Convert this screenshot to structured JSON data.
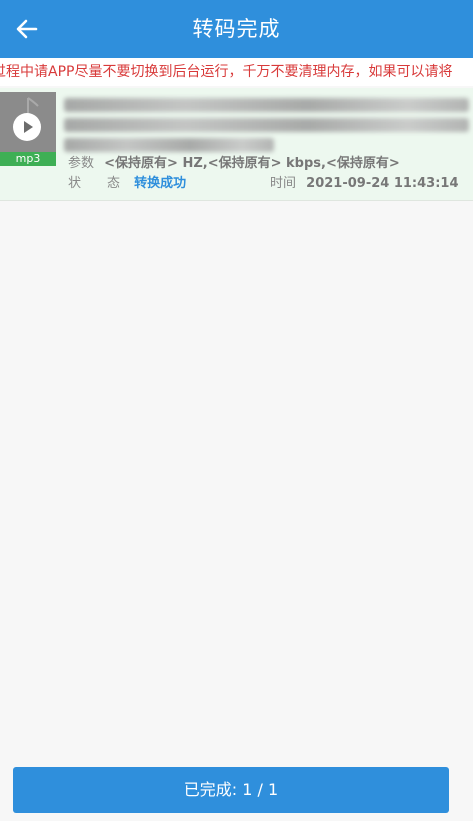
{
  "header": {
    "title": "转码完成"
  },
  "notice": {
    "text": "过程中请APP尽量不要切换到后台运行，千万不要清理内存，如果可以请将"
  },
  "task": {
    "format": "mp3",
    "params_label": "参数",
    "params_value": "<保持原有> HZ,<保持原有> kbps,<保持原有>",
    "status_label": "状　　态",
    "status_value": "转换成功",
    "time_label": "时间",
    "time_value": "2021-09-24 11:43:14"
  },
  "footer": {
    "progress_label": "已完成: 1 / 1"
  },
  "colors": {
    "header_bg": "#2f8fdc",
    "notice_text": "#d83a3a",
    "card_bg": "#edf8ef",
    "status_success": "#2f8fdc",
    "format_tag_bg": "#3eaf55"
  }
}
